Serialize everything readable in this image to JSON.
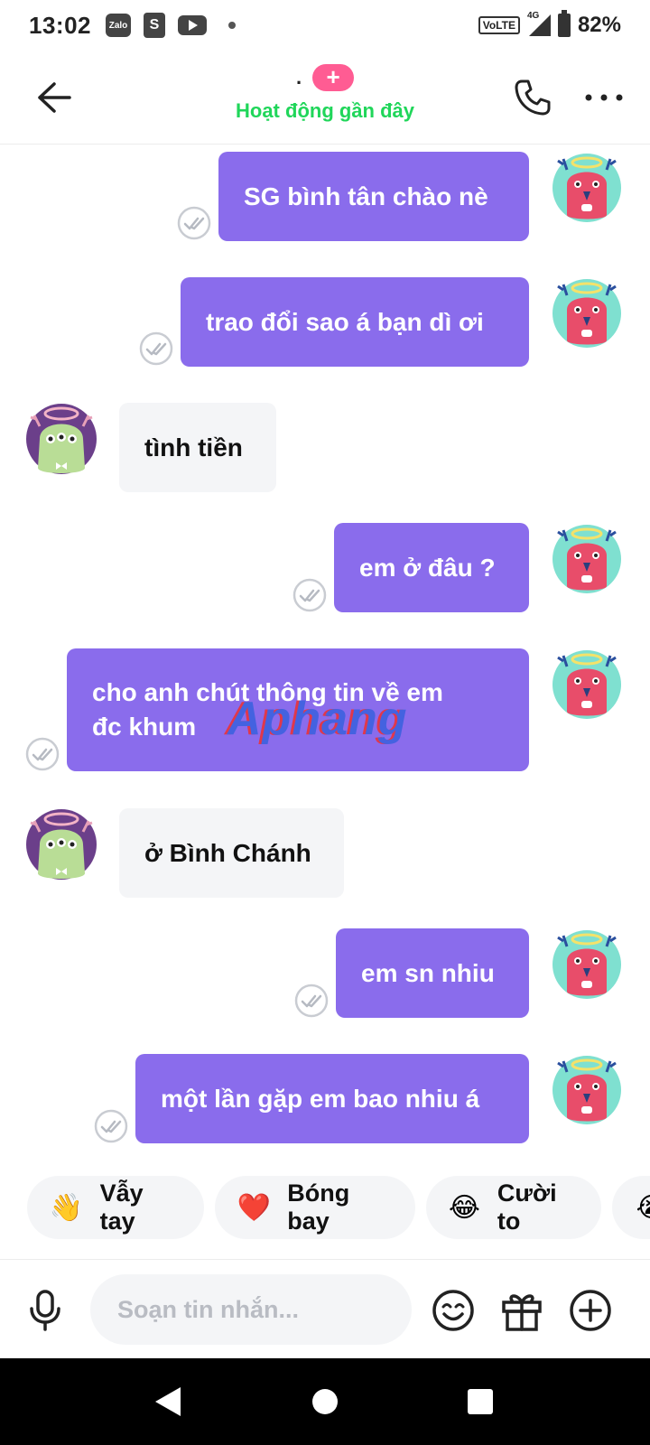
{
  "status_bar": {
    "time": "13:02",
    "apps": [
      "Zalo",
      "S"
    ],
    "volte": "VoLTE",
    "network": "4G",
    "battery": "82%"
  },
  "header": {
    "contact_name": ".",
    "add_friend": "+",
    "status": "Hoạt động gần đây"
  },
  "messages": [
    {
      "side": "out",
      "text": "SG bình tân chào nè"
    },
    {
      "side": "out",
      "text": "trao đổi sao á bạn dì ơi"
    },
    {
      "side": "in",
      "text": "tình tiền"
    },
    {
      "side": "out",
      "text": "em ở đâu ?"
    },
    {
      "side": "out",
      "line1": "cho anh chút thông tin về em",
      "line2": "đc khum"
    },
    {
      "side": "in",
      "text": "ở Bình Chánh"
    },
    {
      "side": "out",
      "text": "em sn nhiu"
    },
    {
      "side": "out",
      "text": "một lần gặp em bao nhiu á"
    }
  ],
  "watermark": "Aphang",
  "quick_reactions": [
    {
      "emoji": "👋",
      "label": "Vẫy tay"
    },
    {
      "emoji": "❤️",
      "label": "Bóng bay"
    },
    {
      "emoji": "😂",
      "label": "Cười to"
    },
    {
      "emoji": "😭",
      "label": ""
    }
  ],
  "input": {
    "placeholder": "Soạn tin nhắn..."
  },
  "colors": {
    "outgoing_bubble": "#8a6cec",
    "incoming_bubble": "#f4f5f7",
    "status_green": "#20d65a",
    "add_badge": "#ff5c93"
  }
}
